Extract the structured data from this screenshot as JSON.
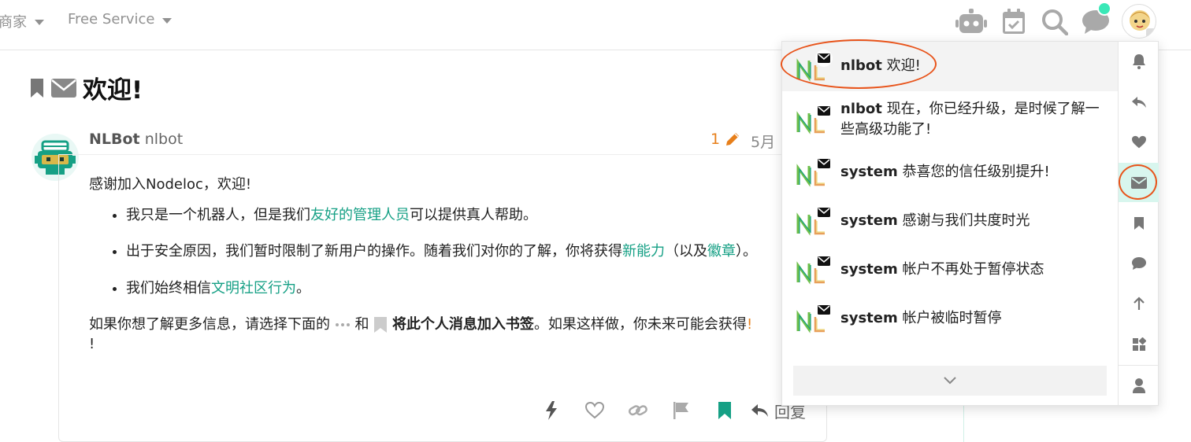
{
  "header": {
    "nav": [
      {
        "label": "商家"
      },
      {
        "label": "Free Service"
      }
    ],
    "icons": [
      "robot-icon",
      "calendar-check-icon",
      "search-icon",
      "chat-icon"
    ],
    "notification_dot_color": "#3ae8b7"
  },
  "topic": {
    "title": "欢迎!"
  },
  "post": {
    "author_name": "NLBot",
    "author_username": "nlbot",
    "edit_count": "1",
    "date": "5月 1",
    "intro": "感谢加入Nodeloc，欢迎!",
    "bullets": [
      {
        "pre": "我只是一个机器人，但是我们",
        "link": "友好的管理人员",
        "post": "可以提供真人帮助。"
      },
      {
        "pre": "出于安全原因，我们暂时限制了新用户的操作。随着我们对你的了解，你将获得",
        "link": "新能力",
        "mid": "（以及",
        "link2": "徽章",
        "post": "）。"
      },
      {
        "pre": "我们始终相信",
        "link": "文明社区行为",
        "post": "。"
      }
    ],
    "outro_pre": "如果你想了解更多信息，请选择下面的",
    "outro_and": "和",
    "outro_bold": "将此个人消息加入书签",
    "outro_post": "。如果这样做，你未来可能会获得",
    "outro_end": "!",
    "reply_label": "回复",
    "accent_color": "#16a085"
  },
  "notifications": [
    {
      "user": "nlbot",
      "text": "欢迎!"
    },
    {
      "user": "nlbot",
      "text": "现在，你已经升级，是时候了解一些高级功能了!"
    },
    {
      "user": "system",
      "text": "恭喜您的信任级别提升!"
    },
    {
      "user": "system",
      "text": "感谢与我们共度时光"
    },
    {
      "user": "system",
      "text": "帐户不再处于暂停状态"
    },
    {
      "user": "system",
      "text": "帐户被临时暂停"
    }
  ],
  "rail": [
    "bell-icon",
    "reply-icon",
    "heart-icon",
    "envelope-icon",
    "bookmark-icon",
    "comment-icon",
    "arrow-up-icon",
    "widgets-icon",
    "user-icon"
  ],
  "highlight_color": "#e8541b"
}
